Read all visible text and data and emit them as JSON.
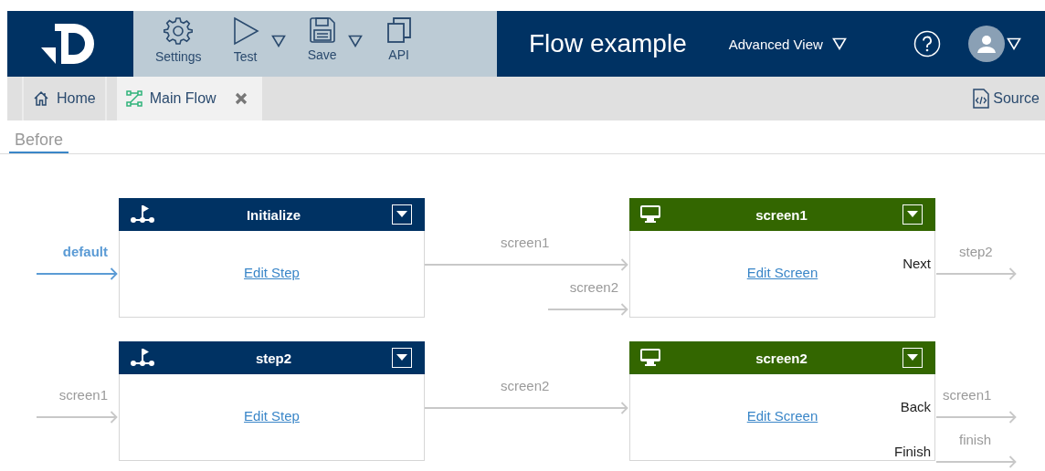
{
  "header": {
    "toolbar": [
      {
        "kind": "settings",
        "label": "Settings",
        "dropdown": false
      },
      {
        "kind": "test",
        "label": "Test",
        "dropdown": true
      },
      {
        "kind": "save",
        "label": "Save",
        "dropdown": true
      },
      {
        "kind": "api",
        "label": "API",
        "dropdown": false
      }
    ],
    "title": "Flow example",
    "view_menu": "Advanced View"
  },
  "tabs": [
    {
      "kind": "home",
      "label": "Home",
      "selected": false,
      "closable": false
    },
    {
      "kind": "flow",
      "label": "Main Flow",
      "selected": true,
      "closable": true
    }
  ],
  "source_button": "Source",
  "section_tab": {
    "label": "Before",
    "selected": true
  },
  "flow": {
    "nodes": [
      {
        "kind": "step",
        "title": "Initialize",
        "link": "Edit Step",
        "inputs": [
          {
            "label": "default",
            "kind": "default"
          }
        ],
        "outputs": [
          {
            "label": "screen1"
          }
        ]
      },
      {
        "kind": "screen",
        "title": "screen1",
        "link": "Edit Screen",
        "inputs": [
          {
            "label": "screen2",
            "kind": "normal"
          }
        ],
        "outputs": [
          {
            "name": "Next",
            "label": "step2"
          }
        ]
      },
      {
        "kind": "step",
        "title": "step2",
        "link": "Edit Step",
        "inputs": [
          {
            "label": "screen1",
            "kind": "normal"
          }
        ],
        "outputs": [
          {
            "label": "screen2"
          }
        ]
      },
      {
        "kind": "screen",
        "title": "screen2",
        "link": "Edit Screen",
        "outputs": [
          {
            "name": "Back",
            "label": "screen1"
          },
          {
            "name": "Finish",
            "label": "finish"
          }
        ]
      }
    ]
  }
}
